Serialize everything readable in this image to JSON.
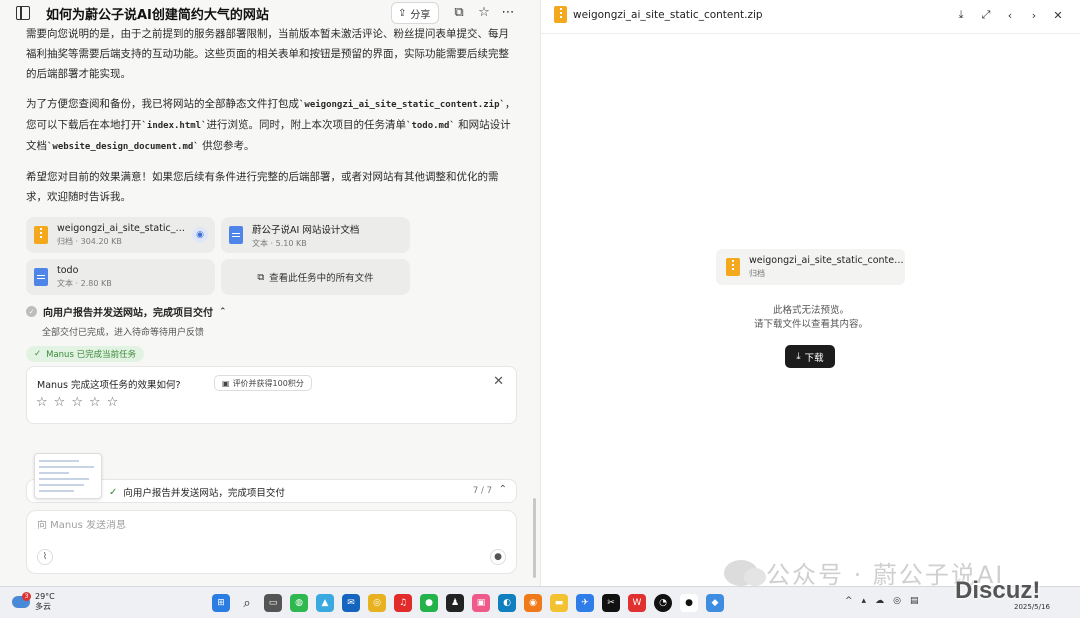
{
  "header": {
    "title": "如何为蔚公子说AI创建简约大气的网站",
    "share_label": "分享"
  },
  "messages": {
    "p1": "需要向您说明的是，由于之前提到的服务器部署限制，当前版本暂未激活评论、粉丝提问表单提交、每月福利抽奖等需要后端支持的互动功能。这些页面的相关表单和按钮是预留的界面，实际功能需要后续完整的后端部署才能实现。",
    "p2_a": "为了方便您查阅和备份，我已将网站的全部静态文件打包成",
    "p2_zip": "`weigongzi_ai_site_static_content.zip`",
    "p2_b": "，您可以下载后在本地打开",
    "p2_index": "`index.html`",
    "p2_c": "进行浏览。同时，附上本次项目的任务清单",
    "p2_todo": "`todo.md`",
    "p2_d": "和网站设计文档",
    "p2_doc": "`website_design_document.md`",
    "p2_e": "供您参考。",
    "p3": "希望您对目前的效果满意！如果您后续有条件进行完整的后端部署，或者对网站有其他调整和优化的需求，欢迎随时告诉我。"
  },
  "files": [
    {
      "name": "weigongzi_ai_site_static_cont...",
      "meta": "归档 · 304.20 KB",
      "type": "zip"
    },
    {
      "name": "蔚公子说AI 网站设计文档",
      "meta": "文本 · 5.10 KB",
      "type": "doc"
    },
    {
      "name": "todo",
      "meta": "文本 · 2.80 KB",
      "type": "doc"
    }
  ],
  "view_all_label": "查看此任务中的所有文件",
  "step": {
    "title": "向用户报告并发送网站，完成项目交付",
    "sub": "全部交付已完成，进入待命等待用户反馈"
  },
  "done_badge": "Manus 已完成当前任务",
  "rating": {
    "question": "Manus 完成这项任务的效果如何?",
    "pill": "评价并获得100积分"
  },
  "progress": {
    "text": "向用户报告并发送网站，完成项目交付",
    "count": "7 / 7"
  },
  "composer": {
    "placeholder": "向 Manus 发送消息"
  },
  "preview": {
    "title": "weigongzi_ai_site_static_content.zip",
    "file_name": "weigongzi_ai_site_static_content.zip",
    "file_meta": "归档",
    "msg1": "此格式无法预览。",
    "msg2": "请下载文件以查看其内容。",
    "download_label": "下载"
  },
  "watermark": "公众号 · 蔚公子说AI",
  "discuz": "Discuz!",
  "taskbar": {
    "weather_temp": "29°C",
    "weather_desc": "多云",
    "weather_badge": "3",
    "date": "2025/5/16"
  },
  "colors": {
    "accent_dark": "#1c1c1c",
    "zip_orange": "#f4a81d",
    "doc_blue": "#4f84e8",
    "success_green": "#3a8a3a"
  }
}
